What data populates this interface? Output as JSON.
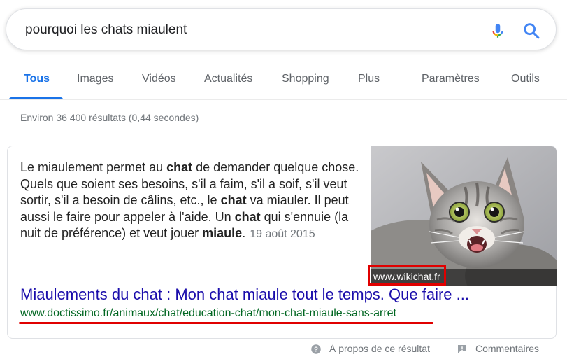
{
  "search": {
    "query": "pourquoi les chats miaulent",
    "mic_icon": "microphone-icon",
    "search_icon": "magnifier-icon"
  },
  "tabs": [
    {
      "label": "Tous",
      "active": true
    },
    {
      "label": "Images"
    },
    {
      "label": "Vidéos"
    },
    {
      "label": "Actualités"
    },
    {
      "label": "Shopping"
    },
    {
      "label": "Plus"
    },
    {
      "label": "Paramètres"
    },
    {
      "label": "Outils"
    }
  ],
  "stats": "Environ 36 400 résultats (0,44 secondes)",
  "featured": {
    "snippet_parts": [
      {
        "t": "Le miaulement permet au "
      },
      {
        "t": "chat",
        "b": true
      },
      {
        "t": " de demander quelque chose. Quels que soient ses besoins, s'il a faim, s'il a soif, s'il veut sortir, s'il a besoin de câlins, etc., le "
      },
      {
        "t": "chat",
        "b": true
      },
      {
        "t": " va miauler. Il peut aussi le faire pour appeler à l'aide. Un "
      },
      {
        "t": "chat",
        "b": true
      },
      {
        "t": " qui s'ennuie (la nuit de préférence) et veut jouer "
      },
      {
        "t": "miaule",
        "b": true
      },
      {
        "t": "."
      }
    ],
    "date": "19 août 2015",
    "image_caption": "www.wikichat.fr",
    "title": "Miaulements du chat : Mon chat miaule tout le temps. Que faire ...",
    "url": "www.doctissimo.fr/animaux/chat/education-chat/mon-chat-miaule-sans-arret"
  },
  "footer": {
    "about": "À propos de ce résultat",
    "feedback": "Commentaires"
  },
  "colors": {
    "accent": "#1a73e8",
    "link": "#1a0dab",
    "url": "#006621",
    "highlight": "#e00000"
  }
}
